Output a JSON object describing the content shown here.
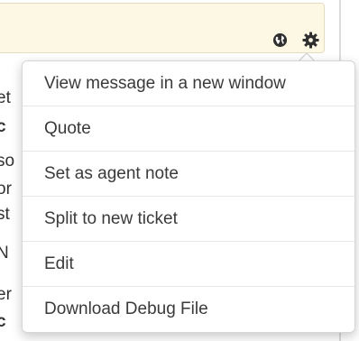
{
  "header": {
    "globe_icon": "globe-icon",
    "gear_icon": "gear-icon",
    "background_color": "#fcf8e3"
  },
  "background_text": {
    "lines": [
      {
        "text": "et",
        "bold": false
      },
      {
        "text": "c",
        "bold": true
      },
      {
        "text": "so",
        "bold": false
      },
      {
        "text": "or",
        "bold": false
      },
      {
        "text": "st",
        "bold": false
      },
      {
        "text": "N",
        "bold": false
      },
      {
        "text": "er",
        "bold": false
      },
      {
        "text": "c",
        "bold": true
      }
    ]
  },
  "menu": {
    "items": [
      {
        "label": "View message in a new window"
      },
      {
        "label": "Quote"
      },
      {
        "label": "Set as agent note"
      },
      {
        "label": "Split to new ticket"
      },
      {
        "label": "Edit"
      },
      {
        "label": "Download Debug File"
      }
    ]
  }
}
